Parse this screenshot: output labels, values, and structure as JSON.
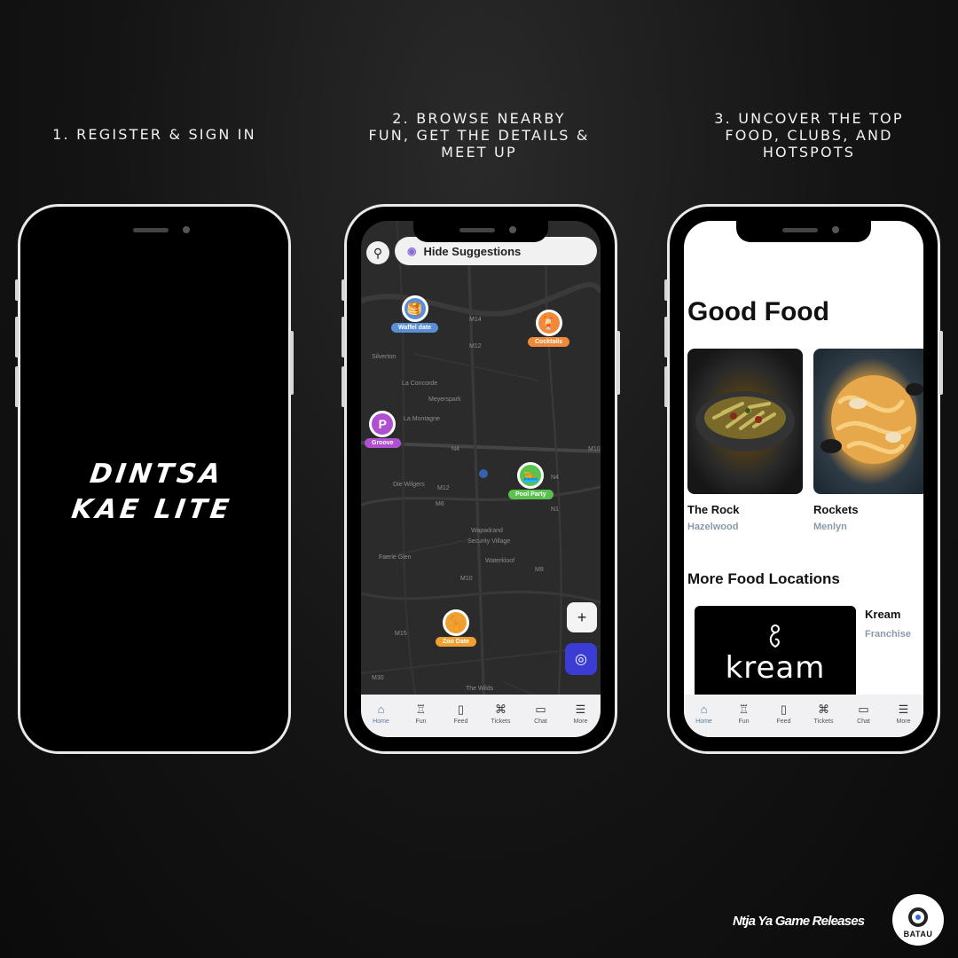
{
  "steps": [
    {
      "title": "1.  REGISTER & SIGN IN"
    },
    {
      "title": "2. BROWSE NEARBY\nFUN, GET THE DETAILS &\nMEET UP"
    },
    {
      "title": "3. UNCOVER THE TOP\nFOOD, CLUBS, AND\nHOTSPOTS"
    }
  ],
  "phone1": {
    "brand": "DINTSA\nKAE LITE"
  },
  "phone2": {
    "search_icon": "search-icon",
    "hide_suggestions": "Hide Suggestions",
    "pins": [
      {
        "label": "Waffel date",
        "color": "#5a8fd6",
        "icon": "🥞"
      },
      {
        "label": "Cocktails",
        "color": "#f08a3a",
        "icon": "🍹"
      },
      {
        "label": "Groove",
        "color": "#b04fd0",
        "icon": "P"
      },
      {
        "label": "Pool Party",
        "color": "#5ac24f",
        "icon": "🏊"
      },
      {
        "label": "Zoo Date",
        "color": "#f0a030",
        "icon": "🦒"
      }
    ],
    "map_labels": [
      "M14",
      "M12",
      "Silverton",
      "La Concorde",
      "Meyerspark",
      "La Montagne",
      "N4",
      "M10",
      "Die Wilgers",
      "M12",
      "M6",
      "Wapadrand",
      "Security Village",
      "Waterkloof",
      "Faerie Glen",
      "M10",
      "M15",
      "M30",
      "The Wilds",
      "N4",
      "M8",
      "N1"
    ],
    "zoom_in": "+",
    "locate_icon": "locate-icon"
  },
  "nav": [
    {
      "label": "Home",
      "icon": "⌂"
    },
    {
      "label": "Fun",
      "icon": "♖"
    },
    {
      "label": "Feed",
      "icon": "▯"
    },
    {
      "label": "Tickets",
      "icon": "⌘"
    },
    {
      "label": "Chat",
      "icon": "▭"
    },
    {
      "label": "More",
      "icon": "☰"
    }
  ],
  "phone3": {
    "title": "Good Food",
    "cards": [
      {
        "name": "The Rock",
        "location": "Hazelwood"
      },
      {
        "name": "Rockets",
        "location": "Menlyn"
      }
    ],
    "section_title": "More Food Locations",
    "location": {
      "logo_text": "kream",
      "name": "Kream",
      "type": "Franchise"
    }
  },
  "footer": {
    "label": "Ntja Ya Game Releases",
    "logo_text": "BATAU"
  }
}
